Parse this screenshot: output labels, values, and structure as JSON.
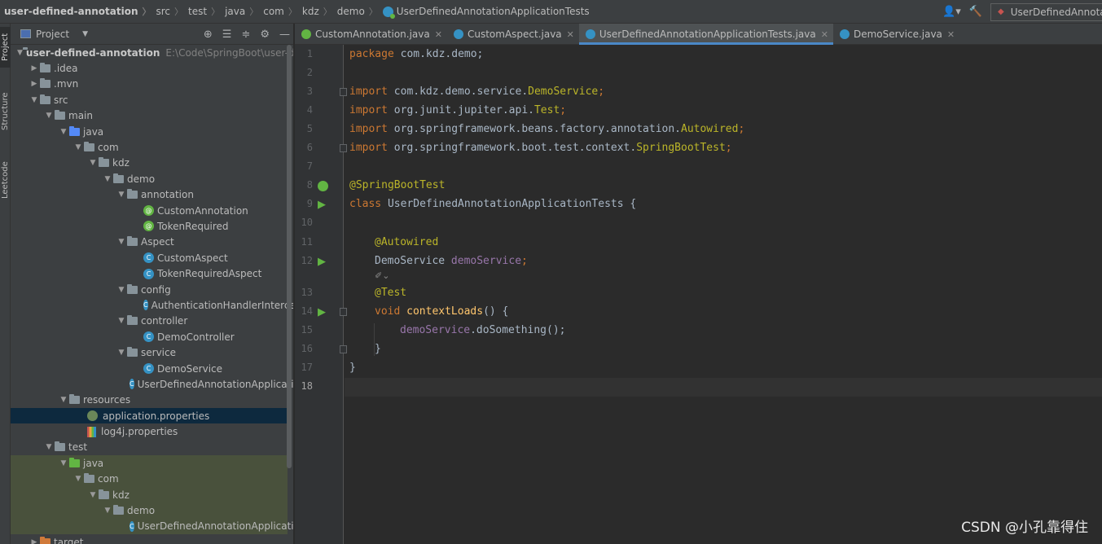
{
  "breadcrumbs": [
    {
      "label": "user-defined-annotation"
    },
    {
      "label": "src"
    },
    {
      "label": "test"
    },
    {
      "label": "java"
    },
    {
      "label": "com"
    },
    {
      "label": "kdz"
    },
    {
      "label": "demo"
    },
    {
      "label": "UserDefinedAnnotationApplicationTests"
    }
  ],
  "run_config": {
    "label": "UserDefinedAnnota"
  },
  "toolstrip": {
    "project": "Project",
    "structure": "Structure",
    "leetcode": "Leetcode"
  },
  "project_panel": {
    "title": "Project",
    "tree": [
      {
        "label": "user-defined-annotation",
        "path": "E:\\Code\\SpringBoot\\user-d"
      },
      {
        "label": ".idea"
      },
      {
        "label": ".mvn"
      },
      {
        "label": "src"
      },
      {
        "label": "main"
      },
      {
        "label": "java"
      },
      {
        "label": "com"
      },
      {
        "label": "kdz"
      },
      {
        "label": "demo"
      },
      {
        "label": "annotation"
      },
      {
        "label": "CustomAnnotation"
      },
      {
        "label": "TokenRequired"
      },
      {
        "label": "Aspect"
      },
      {
        "label": "CustomAspect"
      },
      {
        "label": "TokenRequiredAspect"
      },
      {
        "label": "config"
      },
      {
        "label": "AuthenticationHandlerIntercep"
      },
      {
        "label": "controller"
      },
      {
        "label": "DemoController"
      },
      {
        "label": "service"
      },
      {
        "label": "DemoService"
      },
      {
        "label": "UserDefinedAnnotationApplicatic"
      },
      {
        "label": "resources"
      },
      {
        "label": "application.properties"
      },
      {
        "label": "log4j.properties"
      },
      {
        "label": "test"
      },
      {
        "label": "java"
      },
      {
        "label": "com"
      },
      {
        "label": "kdz"
      },
      {
        "label": "demo"
      },
      {
        "label": "UserDefinedAnnotationApplicatic"
      },
      {
        "label": "target"
      }
    ]
  },
  "tabs": [
    {
      "label": "CustomAnnotation.java"
    },
    {
      "label": "CustomAspect.java"
    },
    {
      "label": "UserDefinedAnnotationApplicationTests.java"
    },
    {
      "label": "DemoService.java"
    }
  ],
  "editor": {
    "line_numbers": [
      "1",
      "2",
      "3",
      "4",
      "5",
      "6",
      "7",
      "8",
      "9",
      "10",
      "11",
      "12",
      "13",
      "14",
      "15",
      "16",
      "17",
      "18"
    ],
    "lines": {
      "l1_kw": "package",
      "l1_rest": " com.kdz.demo;",
      "l3_kw": "import",
      "l3_pkg": " com.kdz.demo.service.",
      "l3_cls": "DemoService",
      "l3_end": ";",
      "l4_kw": "import",
      "l4_pkg": " org.junit.jupiter.api.",
      "l4_cls": "Test",
      "l4_end": ";",
      "l5_kw": "import",
      "l5_pkg": " org.springframework.beans.factory.annotation.",
      "l5_cls": "Autowired",
      "l5_end": ";",
      "l6_kw": "import",
      "l6_pkg": " org.springframework.boot.test.context.",
      "l6_cls": "SpringBootTest",
      "l6_end": ";",
      "l8": "@SpringBootTest",
      "l9_kw": "class",
      "l9_rest": " UserDefinedAnnotationApplicationTests {",
      "l11": "@Autowired",
      "l12_type": "DemoService ",
      "l12_fld": "demoService",
      "l12_end": ";",
      "l13": "@Test",
      "l14_kw": "void",
      "l14_fn": "contextLoads",
      "l14_rest": "() {",
      "l15_fld": "demoService",
      "l15_rest": ".doSomething();",
      "l16": "}",
      "l17": "}"
    }
  },
  "watermark": "CSDN @小孔靠得住"
}
